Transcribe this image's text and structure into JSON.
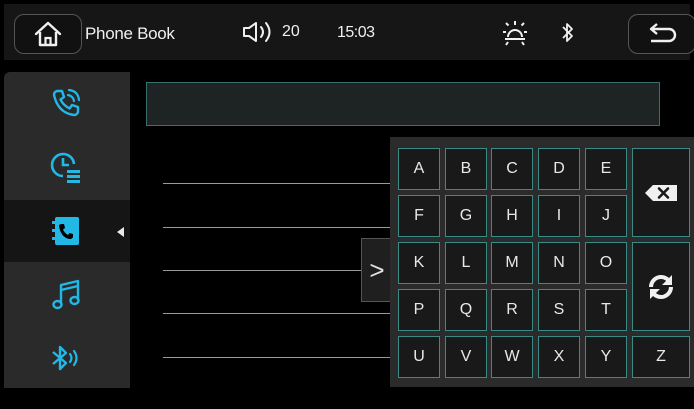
{
  "header": {
    "title": "Phone Book",
    "volume": "20",
    "time": "15:03"
  },
  "sidebar": {
    "items": [
      {
        "icon": "phone-call-icon",
        "active": false
      },
      {
        "icon": "call-history-icon",
        "active": false
      },
      {
        "icon": "contacts-icon",
        "active": true
      },
      {
        "icon": "music-icon",
        "active": false
      },
      {
        "icon": "bluetooth-audio-icon",
        "active": false
      }
    ]
  },
  "search": {
    "value": ""
  },
  "contacts": [
    "",
    "",
    "",
    "",
    ""
  ],
  "collapse_label": ">",
  "keyboard": {
    "rows": [
      [
        "A",
        "B",
        "C",
        "D",
        "E"
      ],
      [
        "F",
        "G",
        "H",
        "I",
        "J"
      ],
      [
        "K",
        "L",
        "M",
        "N",
        "O"
      ],
      [
        "P",
        "Q",
        "R",
        "S",
        "T"
      ],
      [
        "U",
        "V",
        "W",
        "X",
        "Y"
      ]
    ],
    "z_key": "Z",
    "backspace_icon": "backspace-icon",
    "switch_icon": "switch-input-icon"
  },
  "colors": {
    "accent": "#22b8e6",
    "key_border": "#3a8a86",
    "background": "#000000"
  }
}
